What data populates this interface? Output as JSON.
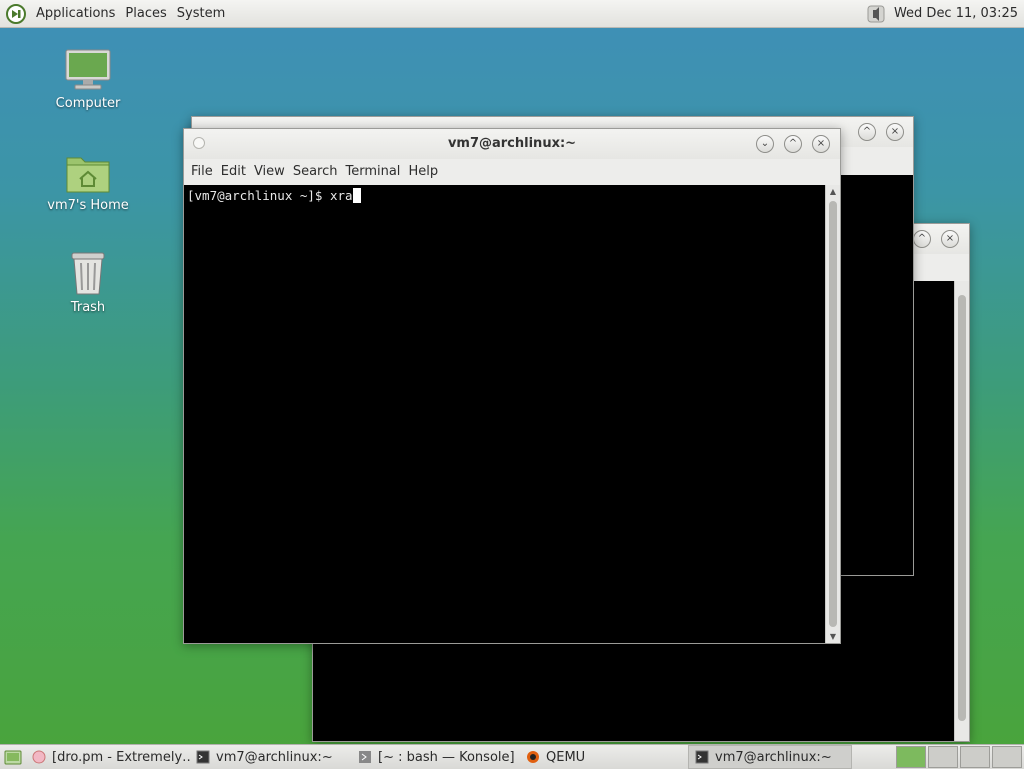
{
  "top_panel": {
    "menus": [
      "Applications",
      "Places",
      "System"
    ],
    "clock": "Wed Dec 11, 03:25"
  },
  "desktop_icons": [
    {
      "label": "Computer",
      "icon": "computer-icon"
    },
    {
      "label": "vm7's Home",
      "icon": "home-folder-icon"
    },
    {
      "label": "Trash",
      "icon": "trash-icon"
    }
  ],
  "main_window": {
    "title": "vm7@archlinux:~",
    "menus": [
      "File",
      "Edit",
      "View",
      "Search",
      "Terminal",
      "Help"
    ],
    "prompt": "[vm7@archlinux ~]$ ",
    "command": "xra"
  },
  "taskbar": {
    "tasks": [
      {
        "label": "[dro.pm - Extremely…",
        "icon": "browser-icon"
      },
      {
        "label": "vm7@archlinux:~",
        "icon": "terminal-icon"
      },
      {
        "label": "[~ : bash — Konsole]",
        "icon": "konsole-icon"
      },
      {
        "label": "QEMU",
        "icon": "qemu-icon"
      },
      {
        "label": "vm7@archlinux:~",
        "icon": "terminal-icon"
      }
    ]
  },
  "colors": {
    "accent_green": "#7dba5e",
    "terminal_bg": "#000000"
  }
}
